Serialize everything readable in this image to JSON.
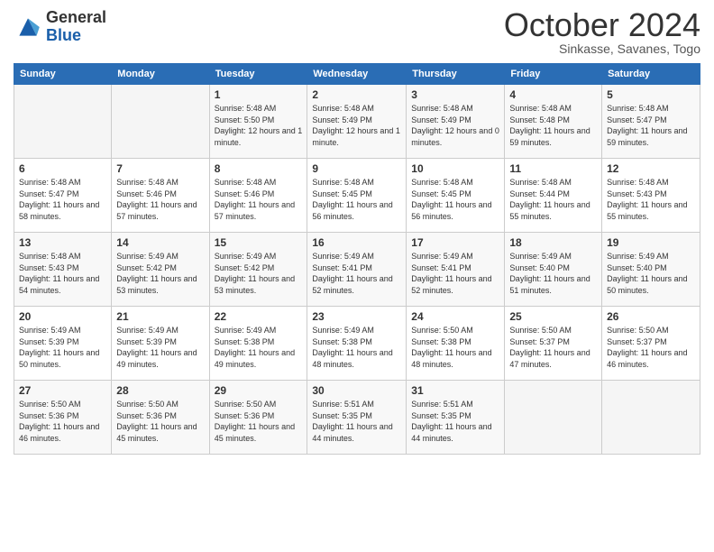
{
  "logo": {
    "general": "General",
    "blue": "Blue"
  },
  "title": "October 2024",
  "subtitle": "Sinkasse, Savanes, Togo",
  "days_of_week": [
    "Sunday",
    "Monday",
    "Tuesday",
    "Wednesday",
    "Thursday",
    "Friday",
    "Saturday"
  ],
  "weeks": [
    [
      {
        "day": "",
        "sunrise": "",
        "sunset": "",
        "daylight": "",
        "empty": true
      },
      {
        "day": "",
        "sunrise": "",
        "sunset": "",
        "daylight": "",
        "empty": true
      },
      {
        "day": "1",
        "sunrise": "Sunrise: 5:48 AM",
        "sunset": "Sunset: 5:50 PM",
        "daylight": "Daylight: 12 hours and 1 minute."
      },
      {
        "day": "2",
        "sunrise": "Sunrise: 5:48 AM",
        "sunset": "Sunset: 5:49 PM",
        "daylight": "Daylight: 12 hours and 1 minute."
      },
      {
        "day": "3",
        "sunrise": "Sunrise: 5:48 AM",
        "sunset": "Sunset: 5:49 PM",
        "daylight": "Daylight: 12 hours and 0 minutes."
      },
      {
        "day": "4",
        "sunrise": "Sunrise: 5:48 AM",
        "sunset": "Sunset: 5:48 PM",
        "daylight": "Daylight: 11 hours and 59 minutes."
      },
      {
        "day": "5",
        "sunrise": "Sunrise: 5:48 AM",
        "sunset": "Sunset: 5:47 PM",
        "daylight": "Daylight: 11 hours and 59 minutes."
      }
    ],
    [
      {
        "day": "6",
        "sunrise": "Sunrise: 5:48 AM",
        "sunset": "Sunset: 5:47 PM",
        "daylight": "Daylight: 11 hours and 58 minutes."
      },
      {
        "day": "7",
        "sunrise": "Sunrise: 5:48 AM",
        "sunset": "Sunset: 5:46 PM",
        "daylight": "Daylight: 11 hours and 57 minutes."
      },
      {
        "day": "8",
        "sunrise": "Sunrise: 5:48 AM",
        "sunset": "Sunset: 5:46 PM",
        "daylight": "Daylight: 11 hours and 57 minutes."
      },
      {
        "day": "9",
        "sunrise": "Sunrise: 5:48 AM",
        "sunset": "Sunset: 5:45 PM",
        "daylight": "Daylight: 11 hours and 56 minutes."
      },
      {
        "day": "10",
        "sunrise": "Sunrise: 5:48 AM",
        "sunset": "Sunset: 5:45 PM",
        "daylight": "Daylight: 11 hours and 56 minutes."
      },
      {
        "day": "11",
        "sunrise": "Sunrise: 5:48 AM",
        "sunset": "Sunset: 5:44 PM",
        "daylight": "Daylight: 11 hours and 55 minutes."
      },
      {
        "day": "12",
        "sunrise": "Sunrise: 5:48 AM",
        "sunset": "Sunset: 5:43 PM",
        "daylight": "Daylight: 11 hours and 55 minutes."
      }
    ],
    [
      {
        "day": "13",
        "sunrise": "Sunrise: 5:48 AM",
        "sunset": "Sunset: 5:43 PM",
        "daylight": "Daylight: 11 hours and 54 minutes."
      },
      {
        "day": "14",
        "sunrise": "Sunrise: 5:49 AM",
        "sunset": "Sunset: 5:42 PM",
        "daylight": "Daylight: 11 hours and 53 minutes."
      },
      {
        "day": "15",
        "sunrise": "Sunrise: 5:49 AM",
        "sunset": "Sunset: 5:42 PM",
        "daylight": "Daylight: 11 hours and 53 minutes."
      },
      {
        "day": "16",
        "sunrise": "Sunrise: 5:49 AM",
        "sunset": "Sunset: 5:41 PM",
        "daylight": "Daylight: 11 hours and 52 minutes."
      },
      {
        "day": "17",
        "sunrise": "Sunrise: 5:49 AM",
        "sunset": "Sunset: 5:41 PM",
        "daylight": "Daylight: 11 hours and 52 minutes."
      },
      {
        "day": "18",
        "sunrise": "Sunrise: 5:49 AM",
        "sunset": "Sunset: 5:40 PM",
        "daylight": "Daylight: 11 hours and 51 minutes."
      },
      {
        "day": "19",
        "sunrise": "Sunrise: 5:49 AM",
        "sunset": "Sunset: 5:40 PM",
        "daylight": "Daylight: 11 hours and 50 minutes."
      }
    ],
    [
      {
        "day": "20",
        "sunrise": "Sunrise: 5:49 AM",
        "sunset": "Sunset: 5:39 PM",
        "daylight": "Daylight: 11 hours and 50 minutes."
      },
      {
        "day": "21",
        "sunrise": "Sunrise: 5:49 AM",
        "sunset": "Sunset: 5:39 PM",
        "daylight": "Daylight: 11 hours and 49 minutes."
      },
      {
        "day": "22",
        "sunrise": "Sunrise: 5:49 AM",
        "sunset": "Sunset: 5:38 PM",
        "daylight": "Daylight: 11 hours and 49 minutes."
      },
      {
        "day": "23",
        "sunrise": "Sunrise: 5:49 AM",
        "sunset": "Sunset: 5:38 PM",
        "daylight": "Daylight: 11 hours and 48 minutes."
      },
      {
        "day": "24",
        "sunrise": "Sunrise: 5:50 AM",
        "sunset": "Sunset: 5:38 PM",
        "daylight": "Daylight: 11 hours and 48 minutes."
      },
      {
        "day": "25",
        "sunrise": "Sunrise: 5:50 AM",
        "sunset": "Sunset: 5:37 PM",
        "daylight": "Daylight: 11 hours and 47 minutes."
      },
      {
        "day": "26",
        "sunrise": "Sunrise: 5:50 AM",
        "sunset": "Sunset: 5:37 PM",
        "daylight": "Daylight: 11 hours and 46 minutes."
      }
    ],
    [
      {
        "day": "27",
        "sunrise": "Sunrise: 5:50 AM",
        "sunset": "Sunset: 5:36 PM",
        "daylight": "Daylight: 11 hours and 46 minutes."
      },
      {
        "day": "28",
        "sunrise": "Sunrise: 5:50 AM",
        "sunset": "Sunset: 5:36 PM",
        "daylight": "Daylight: 11 hours and 45 minutes."
      },
      {
        "day": "29",
        "sunrise": "Sunrise: 5:50 AM",
        "sunset": "Sunset: 5:36 PM",
        "daylight": "Daylight: 11 hours and 45 minutes."
      },
      {
        "day": "30",
        "sunrise": "Sunrise: 5:51 AM",
        "sunset": "Sunset: 5:35 PM",
        "daylight": "Daylight: 11 hours and 44 minutes."
      },
      {
        "day": "31",
        "sunrise": "Sunrise: 5:51 AM",
        "sunset": "Sunset: 5:35 PM",
        "daylight": "Daylight: 11 hours and 44 minutes."
      },
      {
        "day": "",
        "sunrise": "",
        "sunset": "",
        "daylight": "",
        "empty": true
      },
      {
        "day": "",
        "sunrise": "",
        "sunset": "",
        "daylight": "",
        "empty": true
      }
    ]
  ]
}
